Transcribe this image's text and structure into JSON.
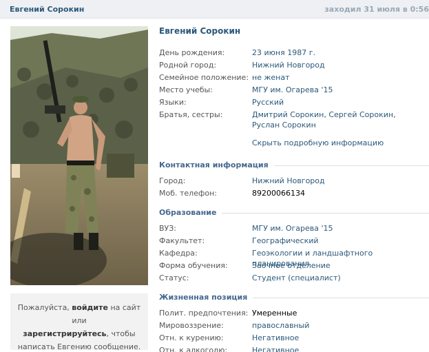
{
  "header": {
    "name": "Евгений Сорокин",
    "status": "заходил 31 июля в 0:56"
  },
  "message_box": {
    "prefix": "Пожалуйста, ",
    "login_link": "войдите",
    "middle": " на сайт или",
    "register_link": "зарегистрируйтесь",
    "suffix": ", чтобы написать Евгению сообщение."
  },
  "profile": {
    "name": "Евгений Сорокин",
    "basic": [
      {
        "label": "День рождения:",
        "value": "23 июня 1987 г."
      },
      {
        "label": "Родной город:",
        "value": "Нижний Новгород"
      },
      {
        "label": "Семейное положение:",
        "value": "не женат"
      },
      {
        "label": "Место учебы:",
        "value": "МГУ им. Огарева '15"
      },
      {
        "label": "Языки:",
        "value": "Русский"
      },
      {
        "label": "Братья, сестры:",
        "value_parts": [
          "Дмитрий Сорокин",
          ", ",
          "Сергей Сорокин",
          ", ",
          "Руслан Сорокин"
        ]
      }
    ],
    "hide_details": "Скрыть подробную информацию",
    "contacts": {
      "title": "Контактная информация",
      "rows": [
        {
          "label": "Город:",
          "value": "Нижний Новгород"
        },
        {
          "label": "Моб. телефон:",
          "value": "89200066134"
        }
      ]
    },
    "education": {
      "title": "Образование",
      "rows": [
        {
          "label": "ВУЗ:",
          "value": "МГУ им. Огарева '15"
        },
        {
          "label": "Факультет:",
          "value": "Географический"
        },
        {
          "label": "Кафедра:",
          "value": "Геоэкологии и ландшафтного планирования"
        },
        {
          "label": "Форма обучения:",
          "value": "Заочное отделение"
        },
        {
          "label": "Статус:",
          "value": "Студент (специалист)"
        }
      ]
    },
    "life_position": {
      "title": "Жизненная позиция",
      "rows": [
        {
          "label": "Полит. предпочтения:",
          "value": "Умеренные"
        },
        {
          "label": "Мировоззрение:",
          "value": "православный"
        },
        {
          "label": "Отн. к курению:",
          "value": "Негативное"
        },
        {
          "label": "Отн. к алкоголю:",
          "value": "Негативное"
        }
      ]
    }
  }
}
